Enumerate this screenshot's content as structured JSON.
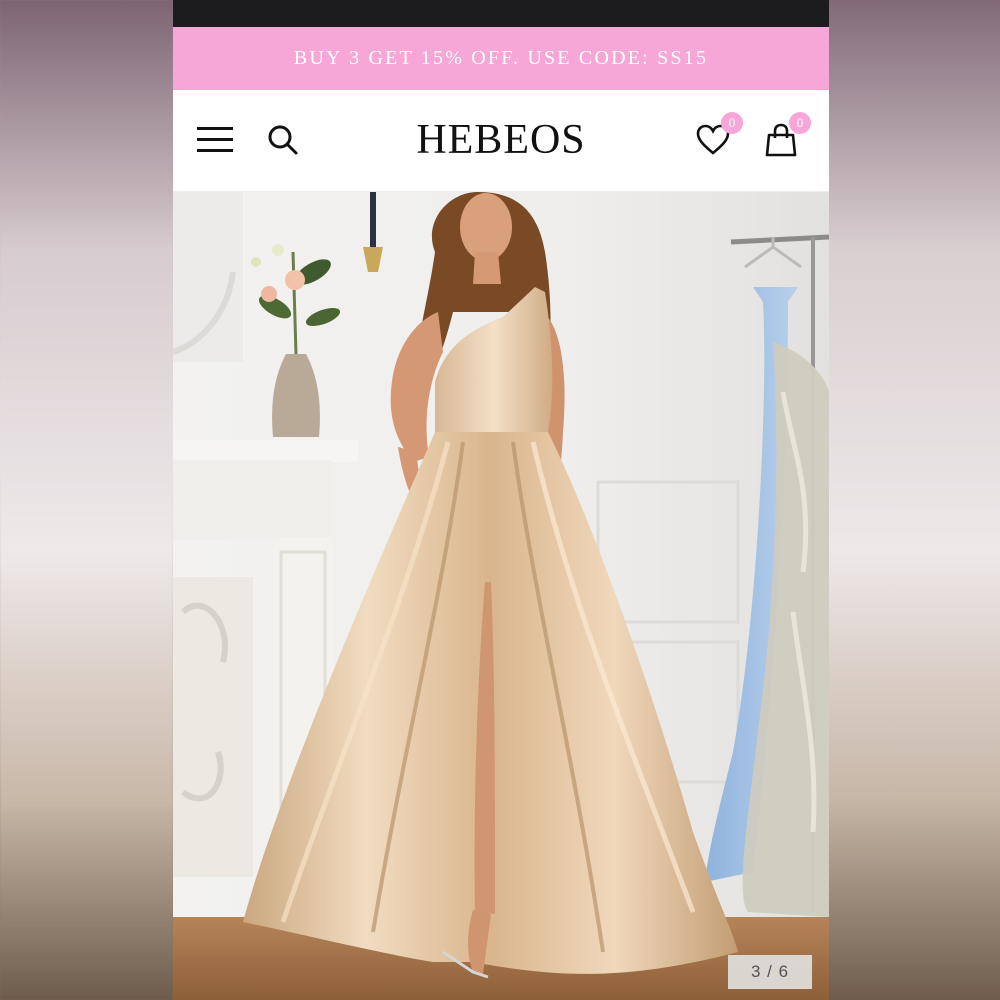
{
  "promo": {
    "text": "BUY 3 GET 15% OFF. USE CODE: SS15",
    "background": "#f7a6d8"
  },
  "header": {
    "logo": "HEBEOS",
    "menu_icon": "hamburger-menu-icon",
    "search_icon": "search-icon",
    "wishlist": {
      "icon": "heart-icon",
      "count": "0"
    },
    "cart": {
      "icon": "shopping-bag-icon",
      "count": "0"
    }
  },
  "product_image": {
    "subject": "champagne one-shoulder satin gown",
    "colors": {
      "dress": "#e4c7a4",
      "wall": "#efeeed",
      "floor": "#a8774c"
    }
  },
  "gallery": {
    "counter": "3 / 6",
    "current": 3,
    "total": 6
  }
}
